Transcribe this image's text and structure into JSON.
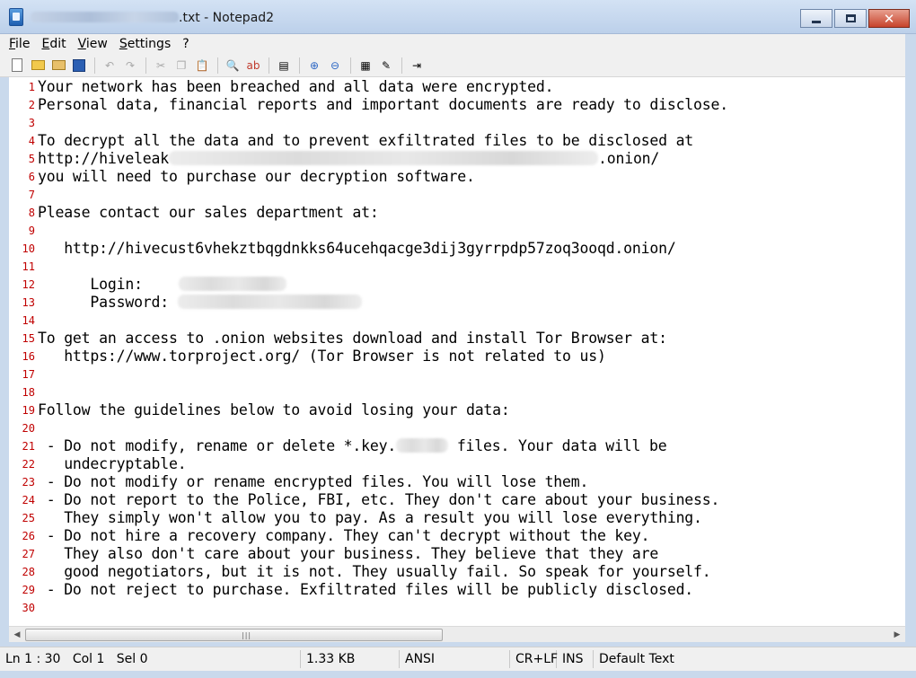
{
  "window": {
    "title_suffix": ".txt - Notepad2",
    "minimize": "",
    "maximize": "",
    "close": "✕"
  },
  "menu": [
    "File",
    "Edit",
    "View",
    "Settings",
    "?"
  ],
  "toolbar_icons": [
    "new-file-icon",
    "open-folder-icon",
    "favorites-icon",
    "save-icon",
    "undo-icon",
    "redo-icon",
    "cut-icon",
    "copy-icon",
    "paste-icon",
    "find-icon",
    "replace-icon",
    "word-wrap-icon",
    "zoom-in-icon",
    "zoom-out-icon",
    "scheme-icon",
    "customize-icon",
    "exit-icon"
  ],
  "editor": {
    "lines": [
      {
        "n": "1",
        "text": "Your network has been breached and all data were encrypted."
      },
      {
        "n": "2",
        "text": "Personal data, financial reports and important documents are ready to disclose."
      },
      {
        "n": "3",
        "text": ""
      },
      {
        "n": "4",
        "text": "To decrypt all the data and to prevent exfiltrated files to be disclosed at"
      },
      {
        "n": "5",
        "text": "http://hiveleak",
        "suffix": ".onion/"
      },
      {
        "n": "6",
        "text": "you will need to purchase our decryption software."
      },
      {
        "n": "7",
        "text": ""
      },
      {
        "n": "8",
        "text": "Please contact our sales department at:"
      },
      {
        "n": "9",
        "text": ""
      },
      {
        "n": "10",
        "text": "   http://hivecust6vhekztbqgdnkks64ucehqacge3dij3gyrrpdp57zoq3ooqd.onion/"
      },
      {
        "n": "11",
        "text": ""
      },
      {
        "n": "12",
        "text": "      Login:"
      },
      {
        "n": "13",
        "text": "      Password:"
      },
      {
        "n": "14",
        "text": ""
      },
      {
        "n": "15",
        "text": "To get an access to .onion websites download and install Tor Browser at:"
      },
      {
        "n": "16",
        "text": "   https://www.torproject.org/ (Tor Browser is not related to us)"
      },
      {
        "n": "17",
        "text": ""
      },
      {
        "n": "18",
        "text": ""
      },
      {
        "n": "19",
        "text": "Follow the guidelines below to avoid losing your data:"
      },
      {
        "n": "20",
        "text": ""
      },
      {
        "n": "21",
        "text": " - Do not modify, rename or delete *.key.",
        "suffix": " files. Your data will be"
      },
      {
        "n": "22",
        "text": "   undecryptable."
      },
      {
        "n": "23",
        "text": " - Do not modify or rename encrypted files. You will lose them."
      },
      {
        "n": "24",
        "text": " - Do not report to the Police, FBI, etc. They don't care about your business."
      },
      {
        "n": "25",
        "text": "   They simply won't allow you to pay. As a result you will lose everything."
      },
      {
        "n": "26",
        "text": " - Do not hire a recovery company. They can't decrypt without the key."
      },
      {
        "n": "27",
        "text": "   They also don't care about your business. They believe that they are"
      },
      {
        "n": "28",
        "text": "   good negotiators, but it is not. They usually fail. So speak for yourself."
      },
      {
        "n": "29",
        "text": " - Do not reject to purchase. Exfiltrated files will be publicly disclosed."
      },
      {
        "n": "30",
        "text": ""
      }
    ]
  },
  "scrollbar": {
    "left": "◀",
    "right": "▶",
    "grip": "|||"
  },
  "status": {
    "position": "Ln 1 : 30   Col 1   Sel 0",
    "size": "1.33 KB",
    "encoding": "ANSI",
    "eol": "CR+LF",
    "mode": "INS",
    "scheme": "Default Text"
  }
}
